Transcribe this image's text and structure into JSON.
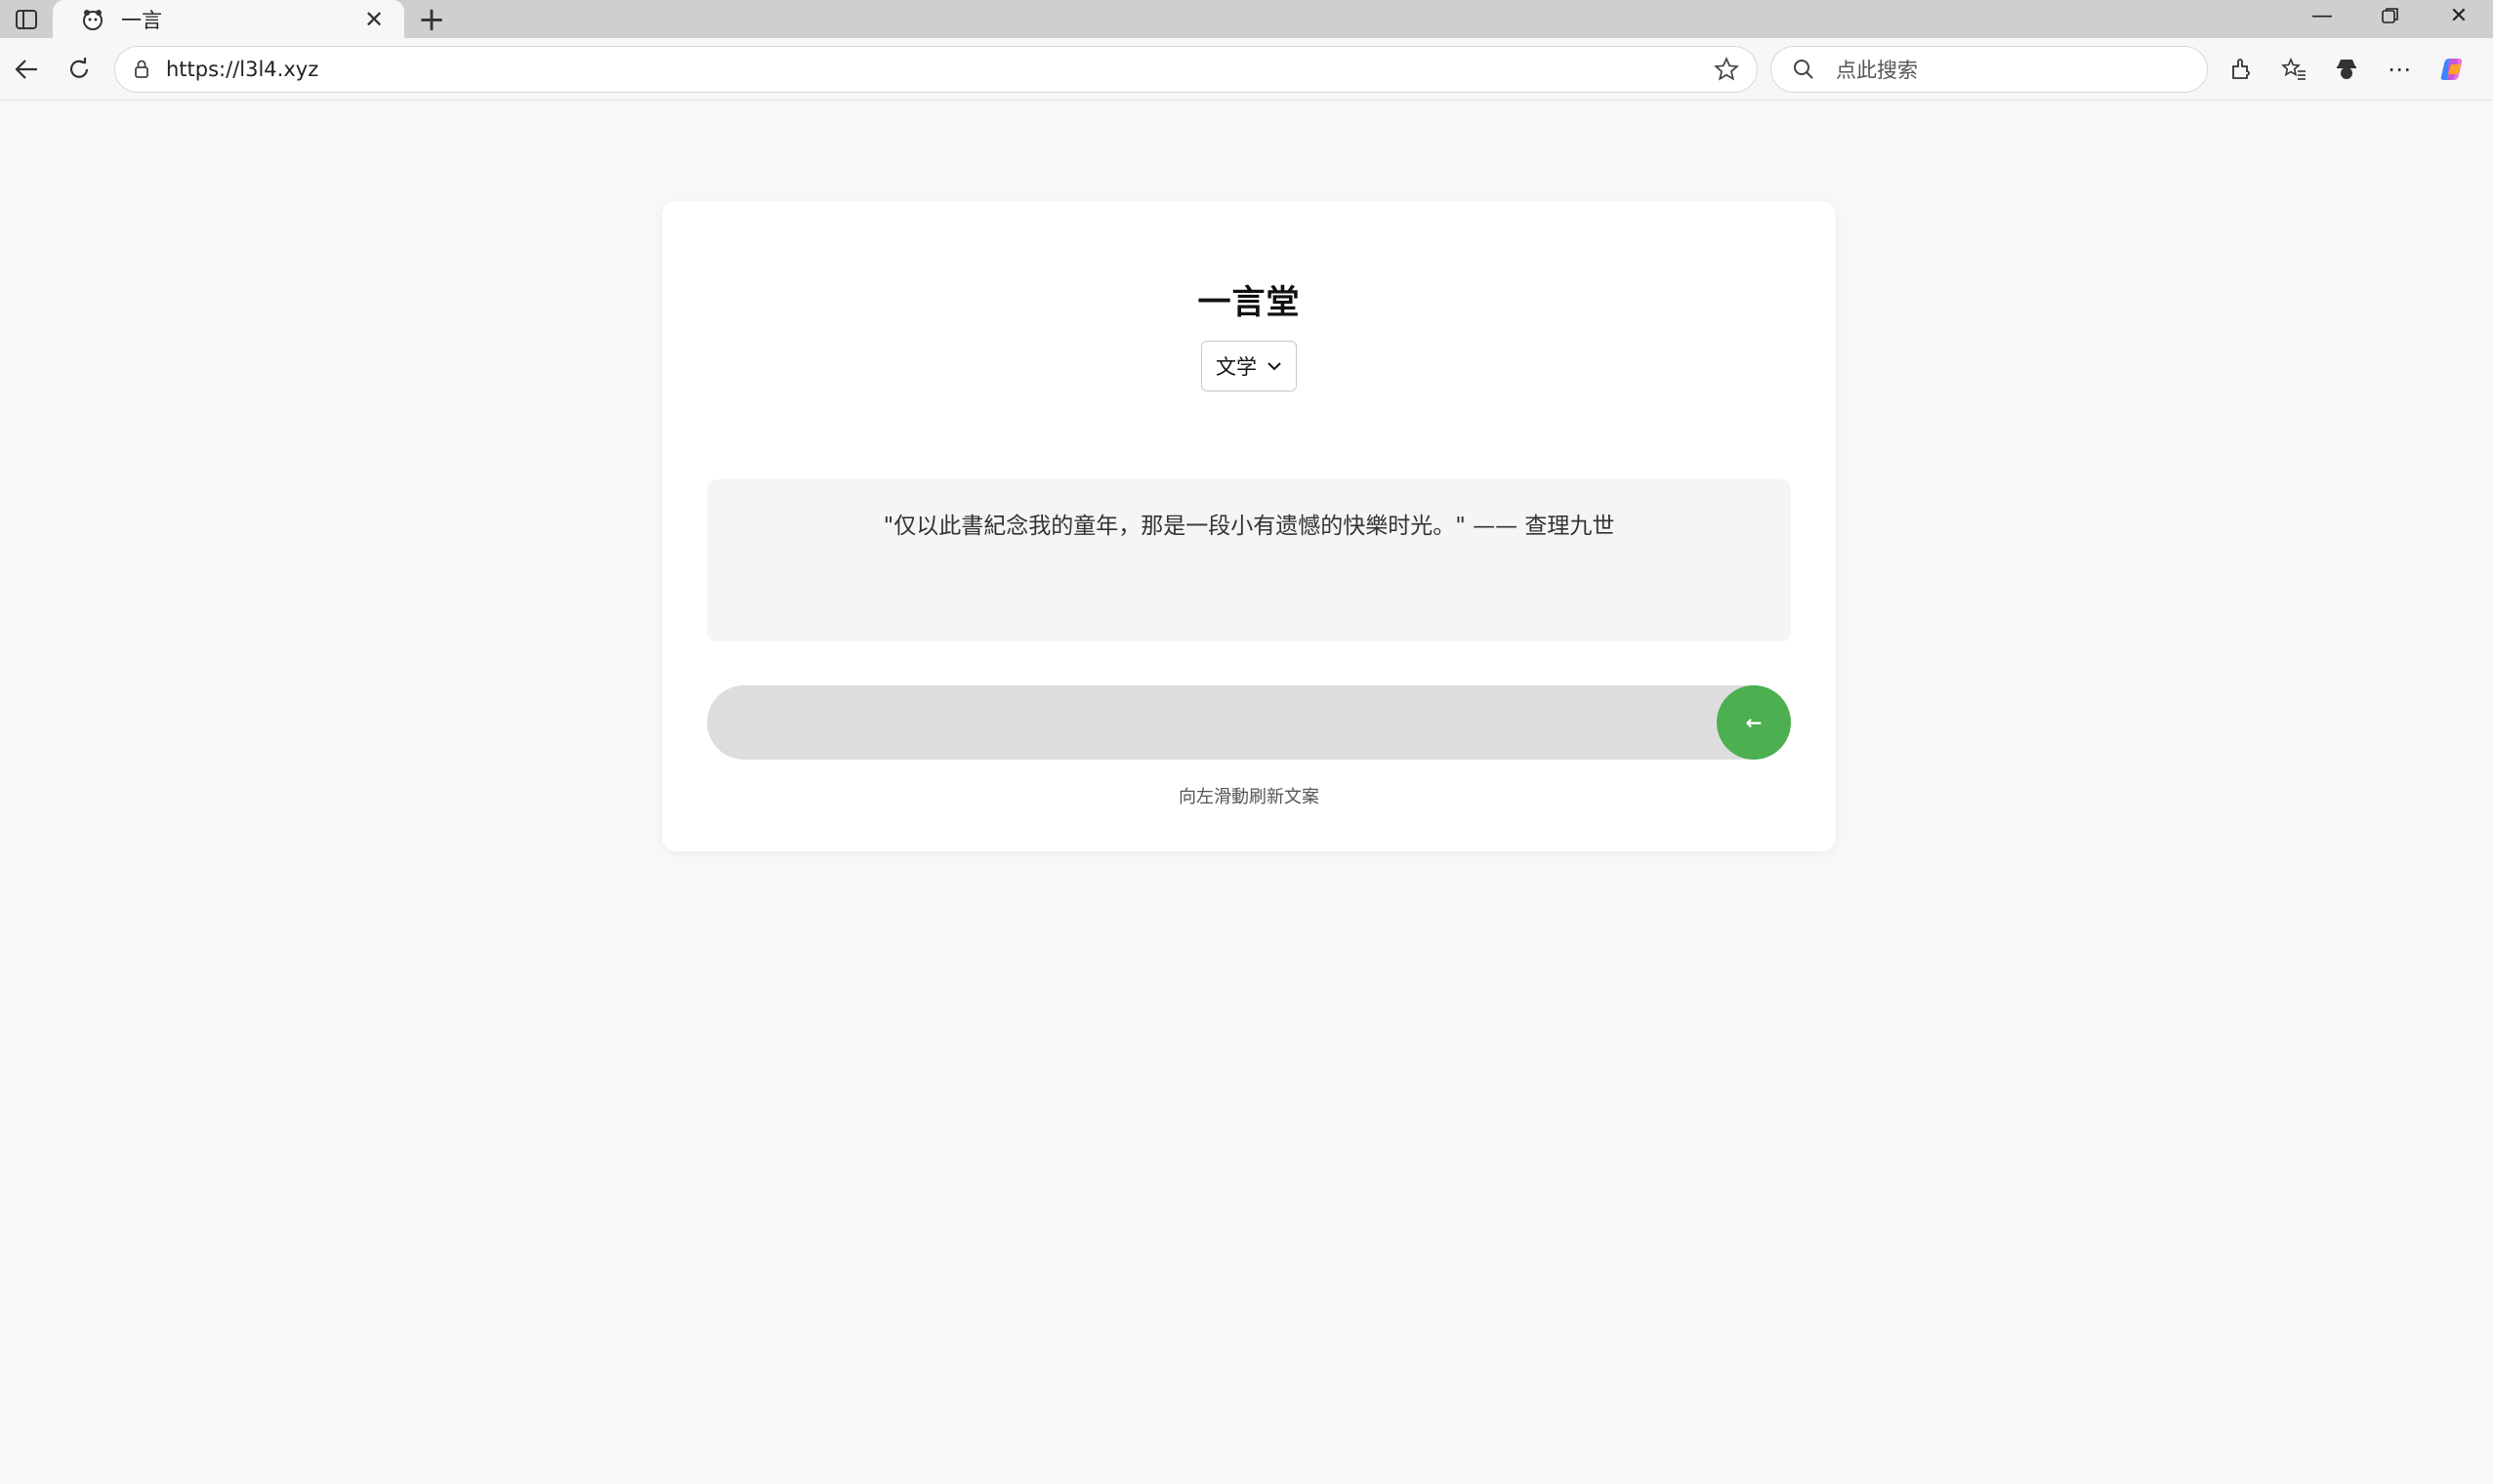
{
  "browser": {
    "tab_title": "一言",
    "url": "https://l3l4.xyz",
    "search_placeholder": "点此搜索"
  },
  "page": {
    "title": "一言堂",
    "category": {
      "selected": "文学"
    },
    "quote": "\"仅以此書紀念我的童年，那是一段小有遗憾的快樂时光。\" —— 查理九世",
    "slider": {
      "handle_label": "←",
      "hint": "向左滑動刷新文案"
    }
  },
  "colors": {
    "accent": "#4caf50",
    "track": "#dddddd",
    "card": "#ffffff",
    "page_bg": "#f8f8f8"
  }
}
